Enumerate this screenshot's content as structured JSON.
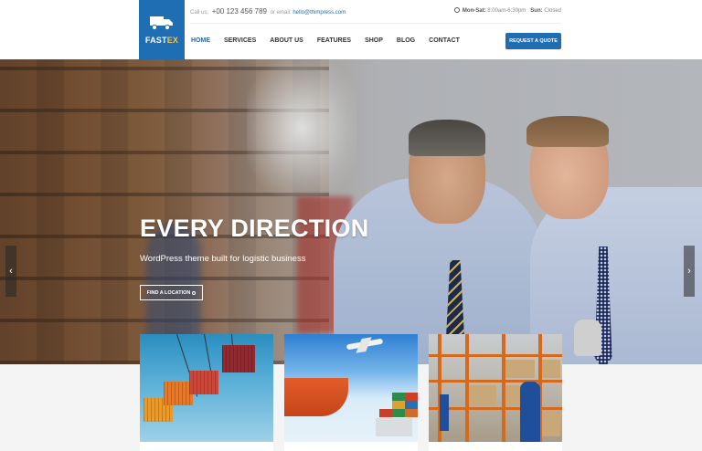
{
  "logo": {
    "name_part1": "FAST",
    "name_part2": "EX"
  },
  "topbar": {
    "call_label": "Call us:",
    "phone": "+00 123 456 789",
    "email_label": "or email:",
    "email": "hello@thimpress.com",
    "hours_label": "Mon-Sat:",
    "hours_value": "8:00am-6:30pm",
    "sunday_label": "Sun:",
    "sunday_value": "Closed"
  },
  "nav": {
    "items": [
      {
        "label": "HOME",
        "active": true
      },
      {
        "label": "SERVICES"
      },
      {
        "label": "ABOUT US"
      },
      {
        "label": "FEATURES"
      },
      {
        "label": "SHOP"
      },
      {
        "label": "BLOG"
      },
      {
        "label": "CONTACT"
      }
    ],
    "cta": "REQUEST A QUOTE"
  },
  "hero": {
    "title": "EVERY DIRECTION",
    "subtitle": "WordPress theme built for logistic business",
    "button": "FIND A LOCATION",
    "prev_arrow": "‹",
    "next_arrow": "›"
  },
  "colors": {
    "brand": "#1f6db3",
    "logo_accent": "#f7c44a"
  },
  "icons": [
    "truck-logo-icon",
    "clock-icon",
    "map-pin-icon",
    "chevron-left-icon",
    "chevron-right-icon"
  ]
}
